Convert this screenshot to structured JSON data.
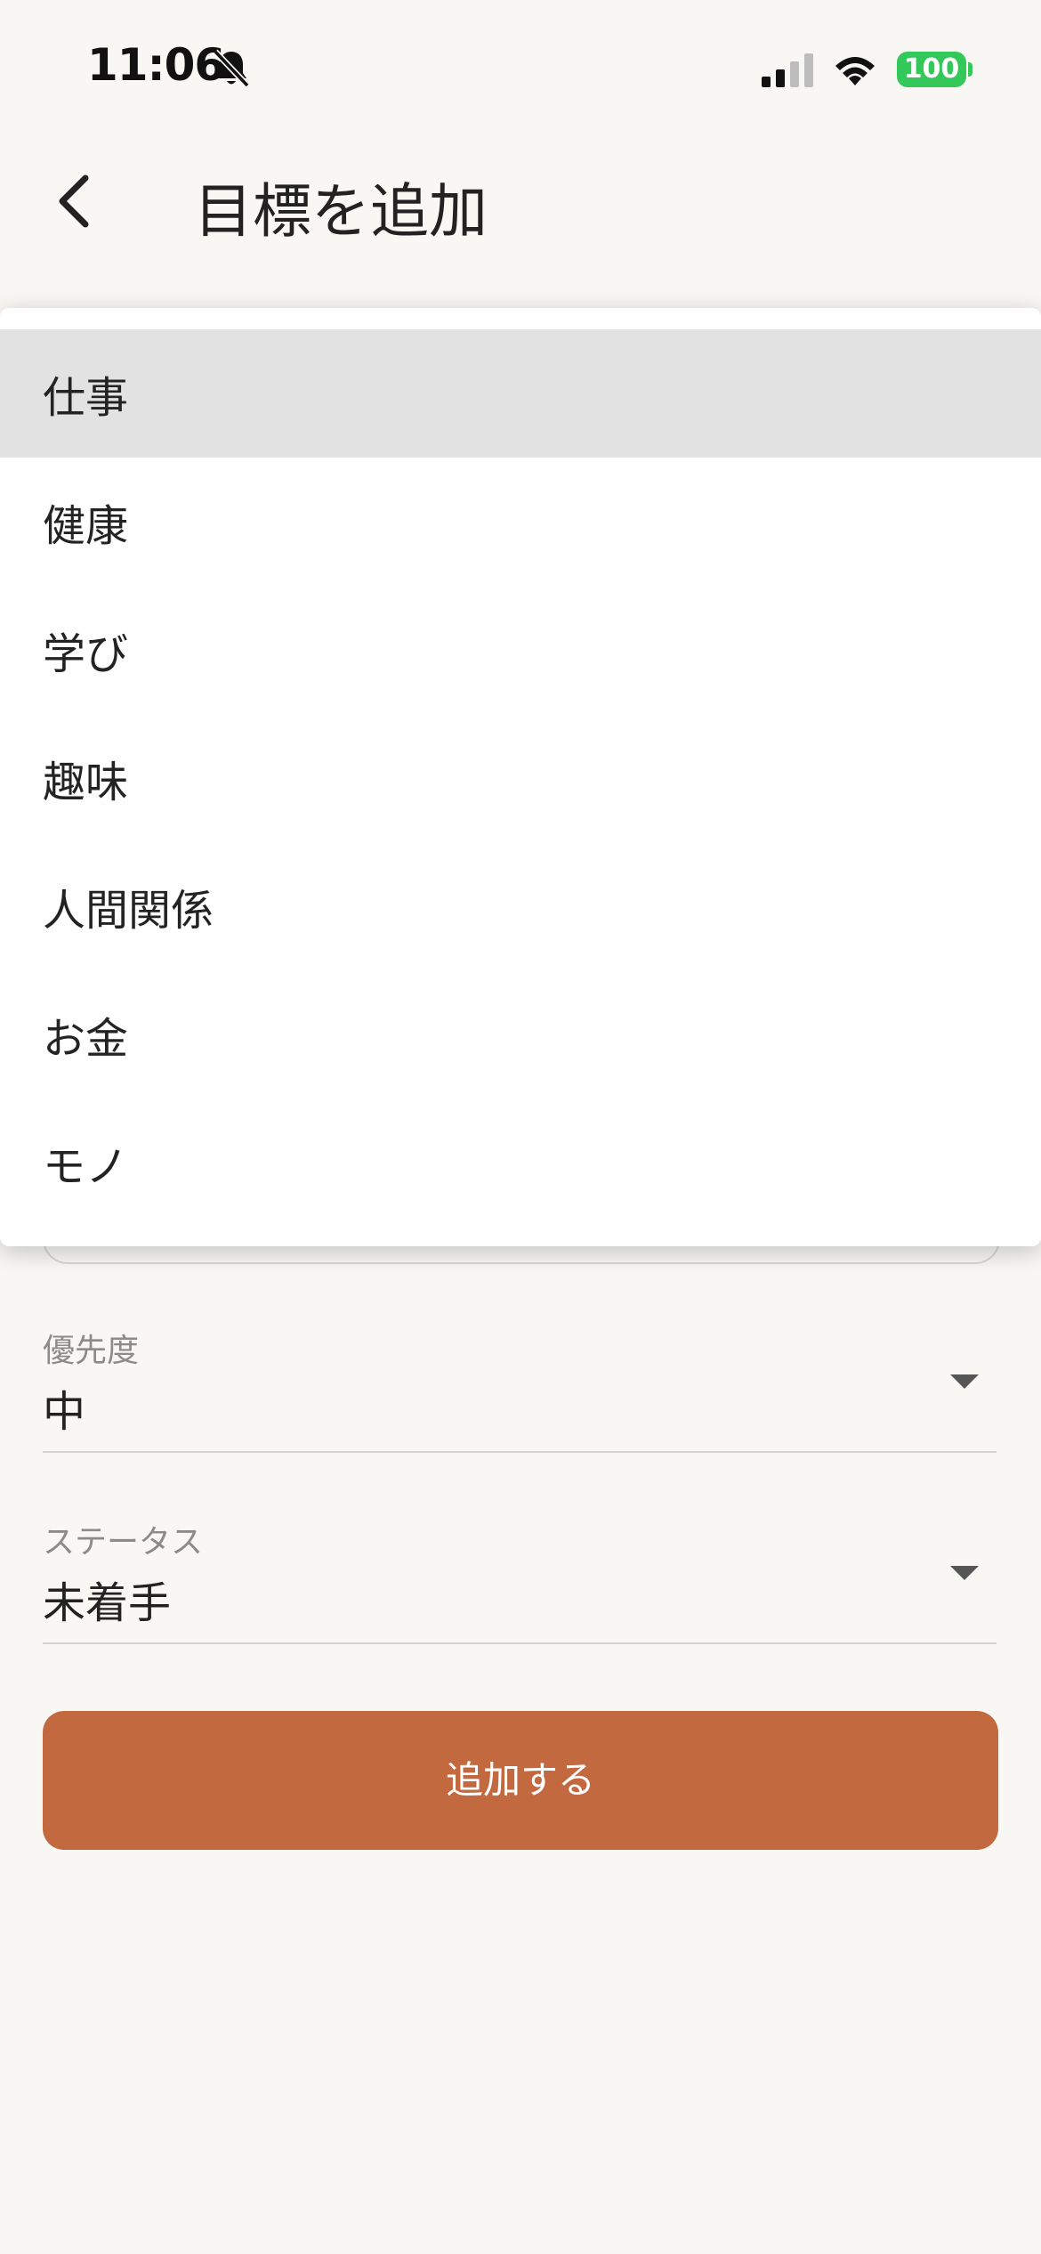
{
  "status_bar": {
    "time": "11:06",
    "battery": "100",
    "battery_color": "#34c759"
  },
  "app_bar": {
    "title": "目標を追加",
    "back_icon": "chevron-left-icon"
  },
  "category_menu": {
    "selected_index": 0,
    "items": [
      {
        "label": "仕事"
      },
      {
        "label": "健康"
      },
      {
        "label": "学び"
      },
      {
        "label": "趣味"
      },
      {
        "label": "人間関係"
      },
      {
        "label": "お金"
      },
      {
        "label": "モノ"
      }
    ]
  },
  "form": {
    "priority": {
      "label": "優先度",
      "value": "中"
    },
    "status": {
      "label": "ステータス",
      "value": "未着手"
    },
    "submit_label": "追加する"
  },
  "colors": {
    "accent": "#c36940",
    "background": "#f8f7f4",
    "menu_selected": "#e2e2e2"
  }
}
